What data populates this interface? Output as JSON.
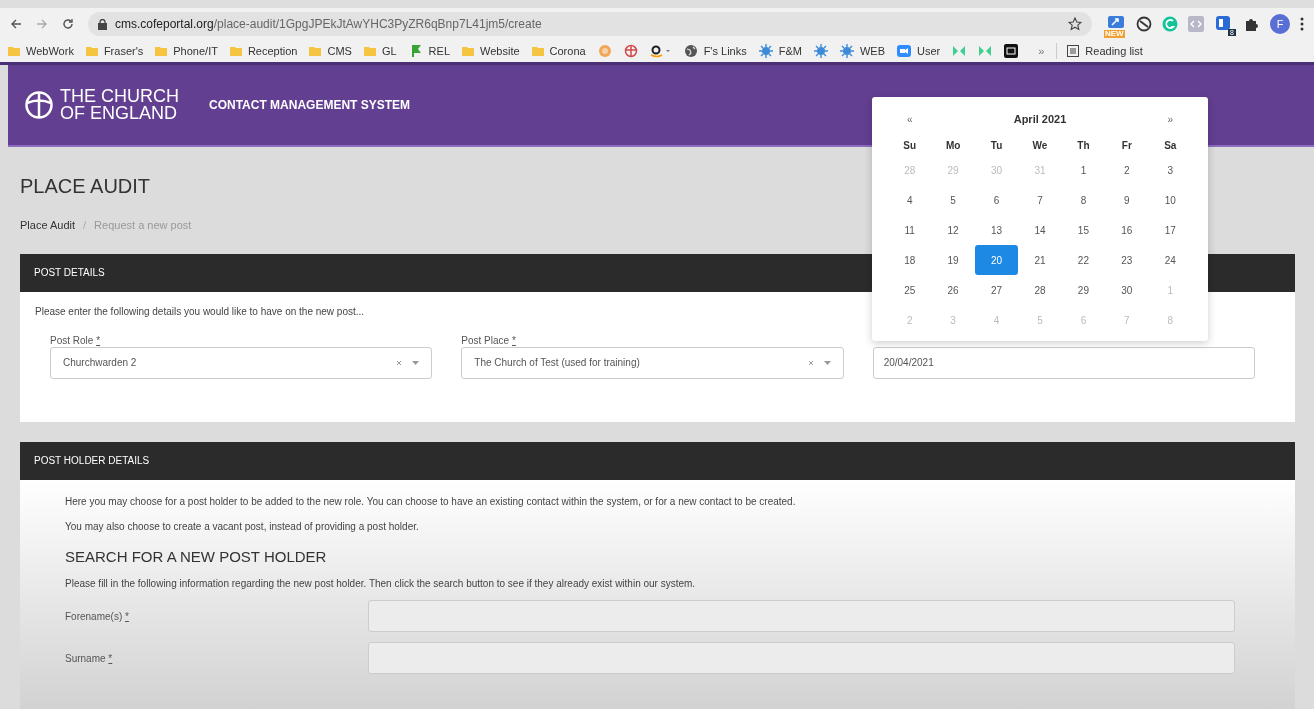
{
  "browser": {
    "url_host": "cms.cofeportal.org",
    "url_path": "/place-audit/1GpgJPEkJtAwYHC3PyZR6qBnp7L41jm5/create",
    "extensions": [
      {
        "kind": "new",
        "badge": "NEW"
      },
      {
        "kind": "blocker"
      },
      {
        "kind": "grammar"
      },
      {
        "kind": "code"
      },
      {
        "kind": "counter",
        "badge": "8"
      },
      {
        "kind": "puzzle"
      }
    ],
    "profile": "F",
    "bookmarks": [
      {
        "kind": "folder",
        "label": "WebWork"
      },
      {
        "kind": "folder",
        "label": "Fraser's"
      },
      {
        "kind": "folder",
        "label": "Phone/IT"
      },
      {
        "kind": "folder",
        "label": "Reception"
      },
      {
        "kind": "folder",
        "label": "CMS"
      },
      {
        "kind": "folder",
        "label": "GL"
      },
      {
        "kind": "flag",
        "label": "REL"
      },
      {
        "kind": "folder",
        "label": "Website"
      },
      {
        "kind": "folder",
        "label": "Corona"
      },
      {
        "kind": "orange"
      },
      {
        "kind": "cross"
      },
      {
        "kind": "amazon"
      },
      {
        "kind": "globe",
        "label": "F's Links"
      },
      {
        "kind": "virus",
        "label": "F&M"
      },
      {
        "kind": "virus"
      },
      {
        "kind": "virus",
        "label": "WEB"
      },
      {
        "kind": "camera",
        "label": "User"
      },
      {
        "kind": "green"
      },
      {
        "kind": "green"
      },
      {
        "kind": "black"
      }
    ],
    "overflow": "»",
    "reading_list": "Reading list"
  },
  "header": {
    "logo_line1": "THE CHURCH",
    "logo_line2": "OF ENGLAND",
    "system": "CONTACT MANAGEMENT SYSTEM"
  },
  "page_title": "PLACE AUDIT",
  "breadcrumb_separator": "/",
  "breadcrumb": [
    {
      "label": "Place Audit",
      "current": false
    },
    {
      "label": "Request a new post",
      "current": true
    }
  ],
  "post_details": {
    "heading": "POST DETAILS",
    "intro": "Please enter the following details you would like to have on the new post...",
    "fields": [
      {
        "kind": "select",
        "label": "Post Role",
        "required": "*",
        "value": "Churchwarden 2"
      },
      {
        "kind": "select",
        "label": "Post Place",
        "required": "*",
        "value": "The Church of Test (used for training)"
      },
      {
        "kind": "date",
        "value": "20/04/2021"
      }
    ]
  },
  "calendar": {
    "prev": "«",
    "next": "»",
    "month": "April 2021",
    "weekdays": [
      "Su",
      "Mo",
      "Tu",
      "We",
      "Th",
      "Fr",
      "Sa"
    ],
    "days": [
      {
        "label": "28",
        "muted": true,
        "selected": false
      },
      {
        "label": "29",
        "muted": true,
        "selected": false
      },
      {
        "label": "30",
        "muted": true,
        "selected": false
      },
      {
        "label": "31",
        "muted": true,
        "selected": false
      },
      {
        "label": "1",
        "muted": false,
        "selected": false
      },
      {
        "label": "2",
        "muted": false,
        "selected": false
      },
      {
        "label": "3",
        "muted": false,
        "selected": false
      },
      {
        "label": "4",
        "muted": false,
        "selected": false
      },
      {
        "label": "5",
        "muted": false,
        "selected": false
      },
      {
        "label": "6",
        "muted": false,
        "selected": false
      },
      {
        "label": "7",
        "muted": false,
        "selected": false
      },
      {
        "label": "8",
        "muted": false,
        "selected": false
      },
      {
        "label": "9",
        "muted": false,
        "selected": false
      },
      {
        "label": "10",
        "muted": false,
        "selected": false
      },
      {
        "label": "11",
        "muted": false,
        "selected": false
      },
      {
        "label": "12",
        "muted": false,
        "selected": false
      },
      {
        "label": "13",
        "muted": false,
        "selected": false
      },
      {
        "label": "14",
        "muted": false,
        "selected": false
      },
      {
        "label": "15",
        "muted": false,
        "selected": false
      },
      {
        "label": "16",
        "muted": false,
        "selected": false
      },
      {
        "label": "17",
        "muted": false,
        "selected": false
      },
      {
        "label": "18",
        "muted": false,
        "selected": false
      },
      {
        "label": "19",
        "muted": false,
        "selected": false
      },
      {
        "label": "20",
        "muted": false,
        "selected": true
      },
      {
        "label": "21",
        "muted": false,
        "selected": false
      },
      {
        "label": "22",
        "muted": false,
        "selected": false
      },
      {
        "label": "23",
        "muted": false,
        "selected": false
      },
      {
        "label": "24",
        "muted": false,
        "selected": false
      },
      {
        "label": "25",
        "muted": false,
        "selected": false
      },
      {
        "label": "26",
        "muted": false,
        "selected": false
      },
      {
        "label": "27",
        "muted": false,
        "selected": false
      },
      {
        "label": "28",
        "muted": false,
        "selected": false
      },
      {
        "label": "29",
        "muted": false,
        "selected": false
      },
      {
        "label": "30",
        "muted": false,
        "selected": false
      },
      {
        "label": "1",
        "muted": true,
        "selected": false
      },
      {
        "label": "2",
        "muted": true,
        "selected": false
      },
      {
        "label": "3",
        "muted": true,
        "selected": false
      },
      {
        "label": "4",
        "muted": true,
        "selected": false
      },
      {
        "label": "5",
        "muted": true,
        "selected": false
      },
      {
        "label": "6",
        "muted": true,
        "selected": false
      },
      {
        "label": "7",
        "muted": true,
        "selected": false
      },
      {
        "label": "8",
        "muted": true,
        "selected": false
      }
    ]
  },
  "post_holder": {
    "heading": "POST HOLDER DETAILS",
    "paragraphs": [
      "Here you may choose for a post holder to be added to the new role. You can choose to have an existing contact within the system, or for a new contact to be created.",
      "You may also choose to create a vacant post, instead of providing a post holder."
    ],
    "search_title": "SEARCH FOR A NEW POST HOLDER",
    "search_intro": "Please fill in the following information regarding the new post holder. Then click the search button to see if they already exist within our system.",
    "fields": [
      {
        "label": "Forename(s)",
        "required": "*"
      },
      {
        "label": "Surname",
        "required": "*"
      }
    ]
  }
}
